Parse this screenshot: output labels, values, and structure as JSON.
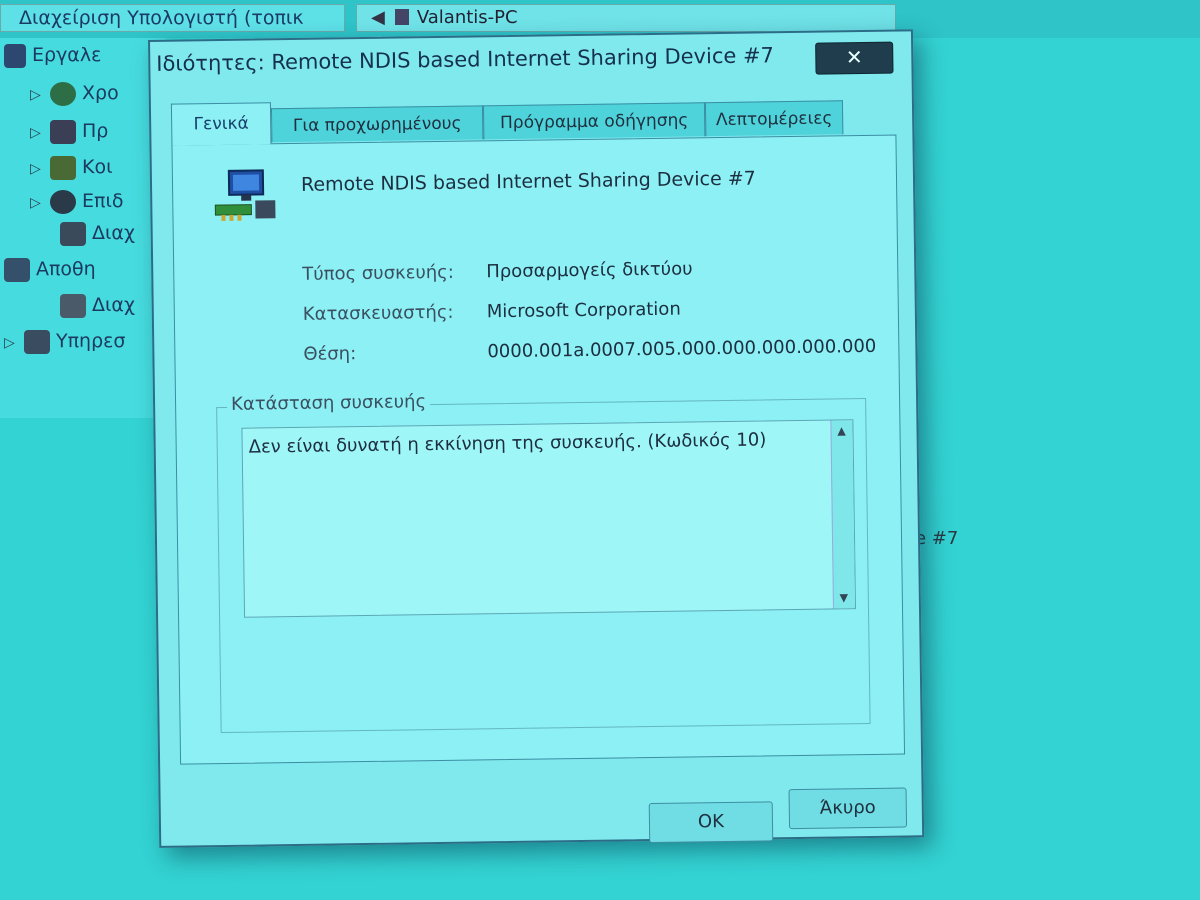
{
  "background": {
    "window_title": "Διαχείριση Υπολογιστή (τοπικ",
    "address_text": "Valantis-PC",
    "tree": [
      {
        "label": "Εργαλε",
        "icon": "tools-icon"
      },
      {
        "label": "Χρο",
        "icon": "clock-icon"
      },
      {
        "label": "Πρ",
        "icon": "scheduler-icon"
      },
      {
        "label": "Κοι",
        "icon": "shared-folders-icon"
      },
      {
        "label": "Επιδ",
        "icon": "performance-icon"
      },
      {
        "label": "Διαχ",
        "icon": "device-manager-icon"
      },
      {
        "label": "Αποθη",
        "icon": "storage-icon"
      },
      {
        "label": "Διαχ",
        "icon": "disk-icon"
      },
      {
        "label": "Υπηρεσ",
        "icon": "services-icon"
      }
    ],
    "list_fragment": "e #7"
  },
  "dialog": {
    "title": "Ιδιότητες: Remote NDIS based Internet Sharing Device #7",
    "close_label": "✕",
    "tabs": [
      {
        "label": "Γενικά",
        "active": true
      },
      {
        "label": "Για προχωρημένους",
        "active": false
      },
      {
        "label": "Πρόγραμμα οδήγησης",
        "active": false
      },
      {
        "label": "Λεπτομέρειες",
        "active": false
      }
    ],
    "device_name": "Remote NDIS based Internet Sharing Device #7",
    "properties": [
      {
        "label": "Τύπος συσκευής:",
        "value": "Προσαρμογείς δικτύου"
      },
      {
        "label": "Κατασκευαστής:",
        "value": "Microsoft Corporation"
      },
      {
        "label": "Θέση:",
        "value": "0000.001a.0007.005.000.000.000.000.000"
      }
    ],
    "status_group_label": "Κατάσταση συσκευής",
    "status_text": "Δεν είναι δυνατή η εκκίνηση της συσκευής. (Κωδικός 10)",
    "ok_label": "OK",
    "cancel_label": "Άκυρο"
  }
}
